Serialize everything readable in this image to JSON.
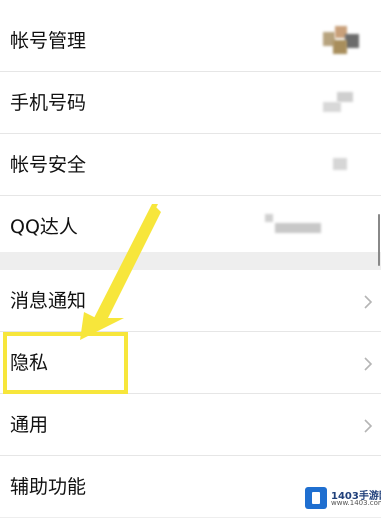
{
  "account_section": {
    "items": [
      {
        "label": "帐号管理"
      },
      {
        "label": "手机号码"
      },
      {
        "label": "帐号安全"
      },
      {
        "label": "QQ达人"
      }
    ]
  },
  "general_section": {
    "items": [
      {
        "label": "消息通知"
      },
      {
        "label": "隐私"
      },
      {
        "label": "通用"
      },
      {
        "label": "辅助功能"
      }
    ]
  },
  "watermark": {
    "text": "1403手游网",
    "sub": "www.1403.com"
  },
  "colors": {
    "highlight": "#f7e63b",
    "background": "#eeeeee",
    "row": "#ffffff",
    "text": "#111111"
  },
  "icons": {
    "chevron": "chevron-right-icon",
    "avatar": "avatar-thumbnail"
  }
}
